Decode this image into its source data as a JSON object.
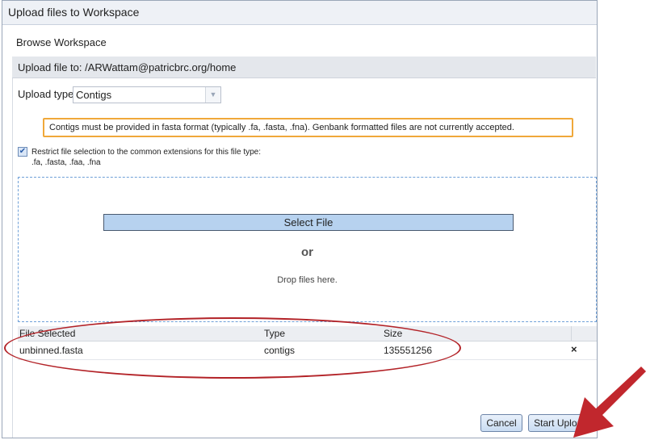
{
  "dialog": {
    "title": "Upload files to Workspace",
    "browse_link": "Browse Workspace",
    "upload_to": "Upload file to: /ARWattam@patricbrc.org/home"
  },
  "upload_type": {
    "label": "Upload type:",
    "value": "Contigs"
  },
  "notice": "Contigs must be provided in fasta format (typically .fa, .fasta, .fna). Genbank formatted files are not currently accepted.",
  "restrict": {
    "checked": true,
    "line1": "Restrict file selection to the common extensions for this file type:",
    "line2": ".fa, .fasta, .faa, .fna"
  },
  "dropzone": {
    "select_button": "Select File",
    "or": "or",
    "drop_text": "Drop files here."
  },
  "files_table": {
    "columns": [
      "File Selected",
      "Type",
      "Size"
    ],
    "rows": [
      {
        "name": "unbinned.fasta",
        "type": "contigs",
        "size": "135551256",
        "remove": "×"
      }
    ]
  },
  "buttons": {
    "cancel": "Cancel",
    "start_upload": "Start Upload"
  },
  "annotation_colors": {
    "highlight": "#b32328",
    "notice_border": "#f0a83a"
  }
}
